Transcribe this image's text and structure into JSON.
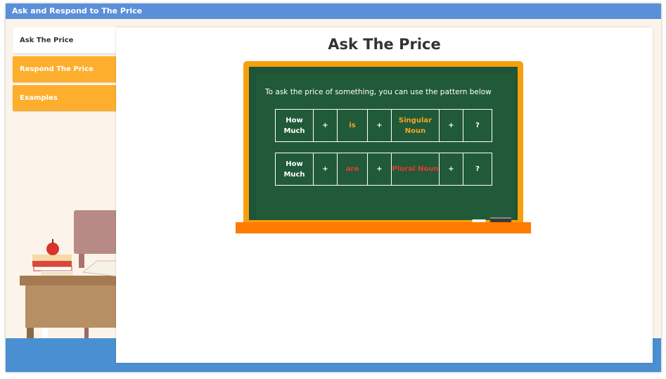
{
  "window": {
    "title": "Ask and Respond to The Price"
  },
  "tabs": [
    {
      "label": "Ask The Price",
      "active": true
    },
    {
      "label": "Respond The Price",
      "active": false
    },
    {
      "label": "Examples",
      "active": false
    }
  ],
  "main": {
    "title": "Ask The Price",
    "intro": "To ask the price of something, you can use the pattern below",
    "patterns": [
      {
        "cells": [
          "How Much",
          "+",
          "is",
          "+",
          "Singular Noun",
          "+",
          "?"
        ]
      },
      {
        "cells": [
          "How Much",
          "+",
          "are",
          "+",
          "Plural Noun",
          "+",
          "?"
        ]
      }
    ]
  },
  "colors": {
    "title_bar": "#5b8fd9",
    "tab_inactive": "#fdae2c",
    "board": "#215a39",
    "board_frame": "#f99f0c",
    "singular_highlight": "#f5a623",
    "plural_highlight": "#e53935"
  }
}
